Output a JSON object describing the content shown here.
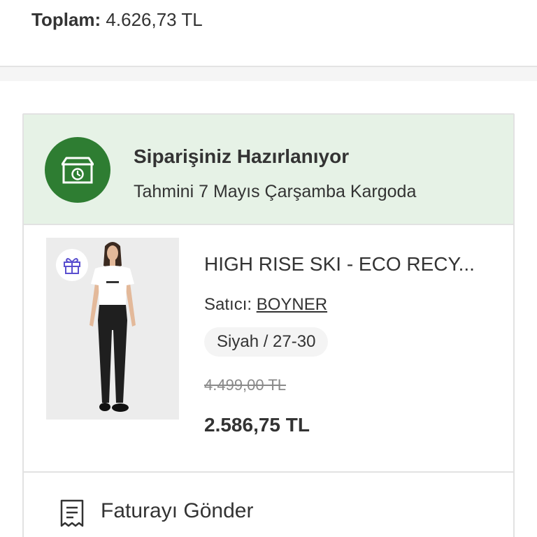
{
  "summary": {
    "total_label": "Toplam:",
    "total_value": "4.626,73 TL"
  },
  "order_status": {
    "icon": "package-clock-icon",
    "title": "Siparişiniz Hazırlanıyor",
    "subtitle": "Tahmini 7 Mayıs Çarşamba Kargoda",
    "accent_color": "#2e7d32",
    "background_color": "#e6f2e6"
  },
  "product": {
    "gift_icon": "gift-icon",
    "name": "HIGH RISE SKI - ECO RECY...",
    "seller_label": "Satıcı:",
    "seller_name": "BOYNER",
    "variant": "Siyah / 27-30",
    "old_price": "4.499,00 TL",
    "price": "2.586,75 TL"
  },
  "actions": {
    "invoice_icon": "receipt-icon",
    "send_invoice_label": "Faturayı Gönder"
  }
}
